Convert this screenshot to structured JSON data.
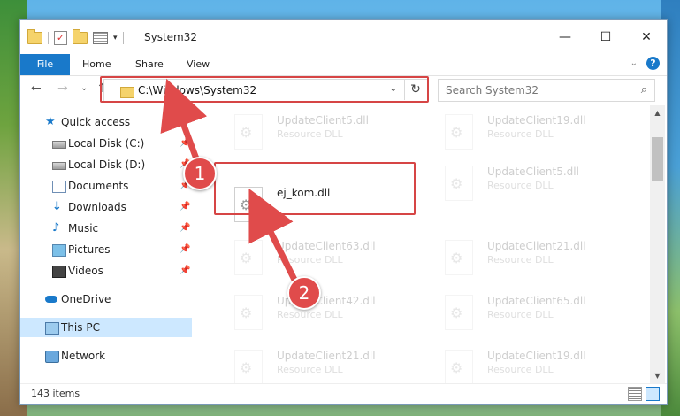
{
  "window": {
    "title": "System32",
    "controls": {
      "minimize": "—",
      "maximize": "☐",
      "close": "✕"
    }
  },
  "ribbon": {
    "file": "File",
    "tabs": [
      "Home",
      "Share",
      "View"
    ]
  },
  "address": {
    "path": "C:\\Windows\\System32",
    "refresh_glyph": "↻",
    "dropdown_glyph": "⌄"
  },
  "search": {
    "placeholder": "Search System32",
    "glyph": "⌕"
  },
  "nav_buttons": {
    "back": "←",
    "forward": "→",
    "recent": "⌄",
    "up": "↑"
  },
  "sidebar": {
    "items": [
      {
        "label": "Quick access",
        "icon": "star-icon"
      },
      {
        "label": "Local Disk (C:)",
        "icon": "drive-icon",
        "pinned": true
      },
      {
        "label": "Local Disk (D:)",
        "icon": "drive-icon",
        "pinned": true
      },
      {
        "label": "Documents",
        "icon": "documents-icon",
        "pinned": true
      },
      {
        "label": "Downloads",
        "icon": "downloads-icon",
        "pinned": true
      },
      {
        "label": "Music",
        "icon": "music-icon",
        "pinned": true
      },
      {
        "label": "Pictures",
        "icon": "pictures-icon",
        "pinned": true
      },
      {
        "label": "Videos",
        "icon": "videos-icon",
        "pinned": true
      },
      {
        "label": "OneDrive",
        "icon": "onedrive-icon"
      },
      {
        "label": "This PC",
        "icon": "computer-icon",
        "selected": true
      },
      {
        "label": "Network",
        "icon": "network-icon"
      }
    ]
  },
  "files": {
    "highlighted": {
      "name": "ej_kom.dll",
      "type": ""
    },
    "faded": [
      {
        "name": "UpdateClient5.dll",
        "type": "Resource DLL"
      },
      {
        "name": "UpdateClient19.dll",
        "type": "Resource DLL"
      },
      {
        "name": "UpdateClient5.dll",
        "type": "Resource DLL"
      },
      {
        "name": "UpdateClient63.dll",
        "type": "Resource DLL"
      },
      {
        "name": "UpdateClient21.dll",
        "type": "Resource DLL"
      },
      {
        "name": "UpdateClient42.dll",
        "type": "Resource DLL"
      },
      {
        "name": "UpdateClient65.dll",
        "type": "Resource DLL"
      },
      {
        "name": "UpdateClient21.dll",
        "type": "Resource DLL"
      },
      {
        "name": "UpdateClient19.dll",
        "type": "Resource DLL"
      }
    ]
  },
  "status": {
    "items_count": "143 items"
  },
  "annotations": {
    "step1": "1",
    "step2": "2",
    "color": "#e04b4b"
  }
}
